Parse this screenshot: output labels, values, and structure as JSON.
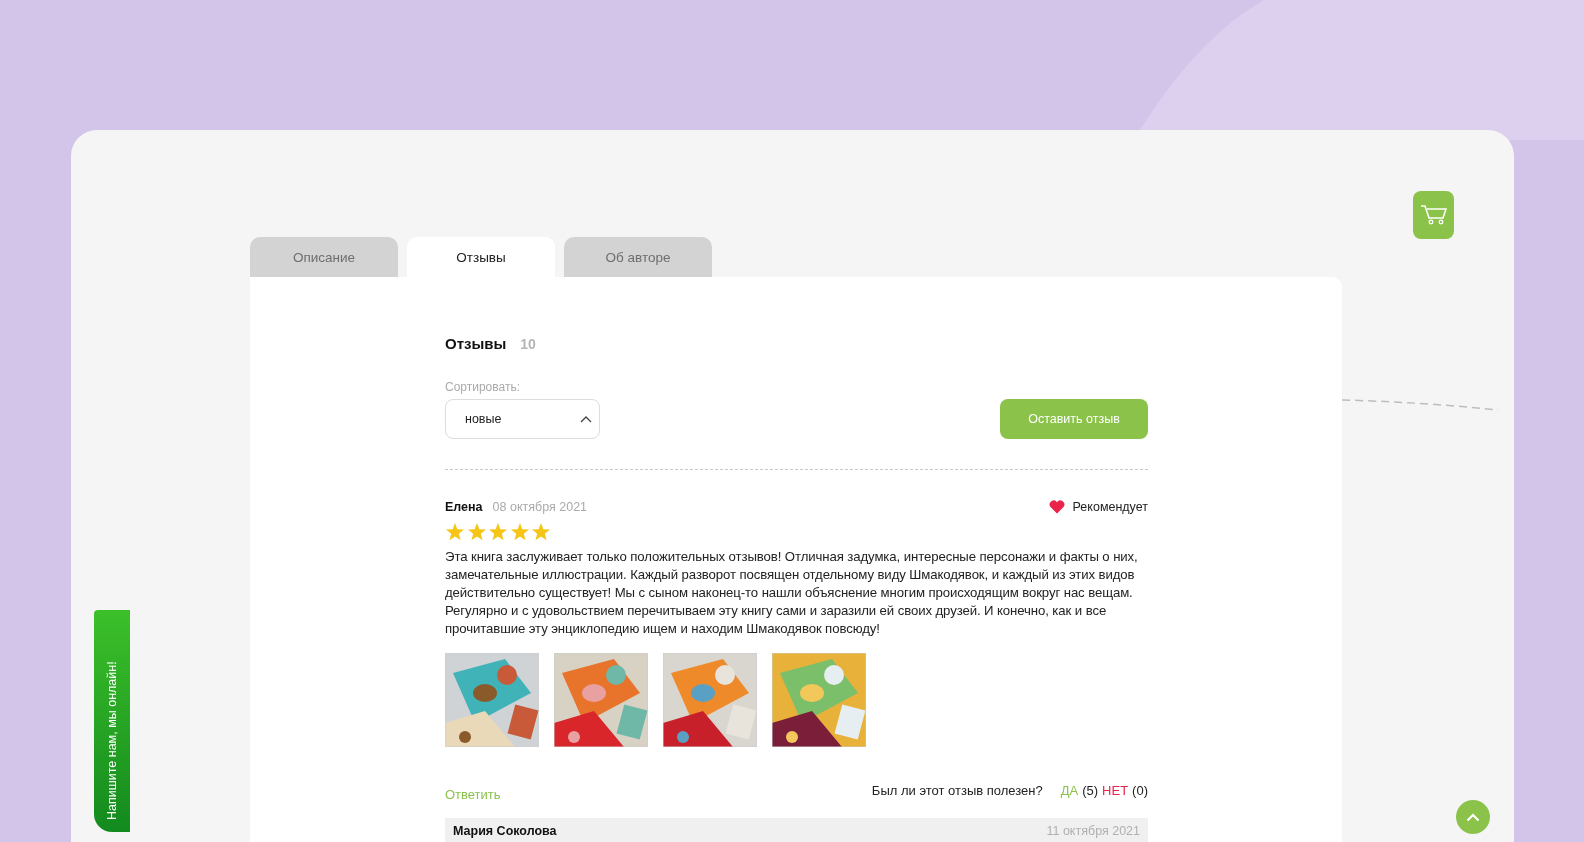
{
  "tabs": [
    {
      "label": "Описание",
      "selected": false
    },
    {
      "label": "Отзывы",
      "selected": true
    },
    {
      "label": "Об авторе",
      "selected": false
    }
  ],
  "reviews_heading": {
    "title": "Отзывы",
    "count": "10"
  },
  "sort": {
    "label": "Сортировать:",
    "value": "новые",
    "expanded": true
  },
  "leave_review_button": "Оставить отзыв",
  "reviews": [
    {
      "author": "Елена",
      "date": "08 октября 2021",
      "recommends": true,
      "recommend_label": "Рекомендует",
      "stars": 5,
      "text": "Эта книга заслуживает только положительных отзывов! Отличная задумка, интересные персонажи и факты о них, замечательные иллюстрации. Каждый разворот посвящен отдельному виду Шмакодявок, и каждый из этих видов действительно существует! Мы с сыном наконец-то нашли объяснение многим происходящим вокруг нас вещам. Регулярно и с удовольствием перечитываем эту книгу сами и заразили ей своих друзей. И конечно, как и все прочитавшие эту энциклопедию ищем и находим Шмакодявок повсюду!",
      "photos": [
        {
          "kind": "picture"
        },
        {
          "kind": "picture"
        },
        {
          "kind": "picture"
        },
        {
          "kind": "picture"
        }
      ],
      "reply_link": "Ответить",
      "helpful_question": "Был ли этот отзыв полезен?",
      "yes_label": "ДА",
      "yes_count": "(5)",
      "no_label": "НЕТ",
      "no_count": "(0)"
    }
  ],
  "reply": {
    "author": "Мария Соколова",
    "date": "11 октября 2021"
  },
  "chat_tab": "Напишите нам, мы онлайн!"
}
